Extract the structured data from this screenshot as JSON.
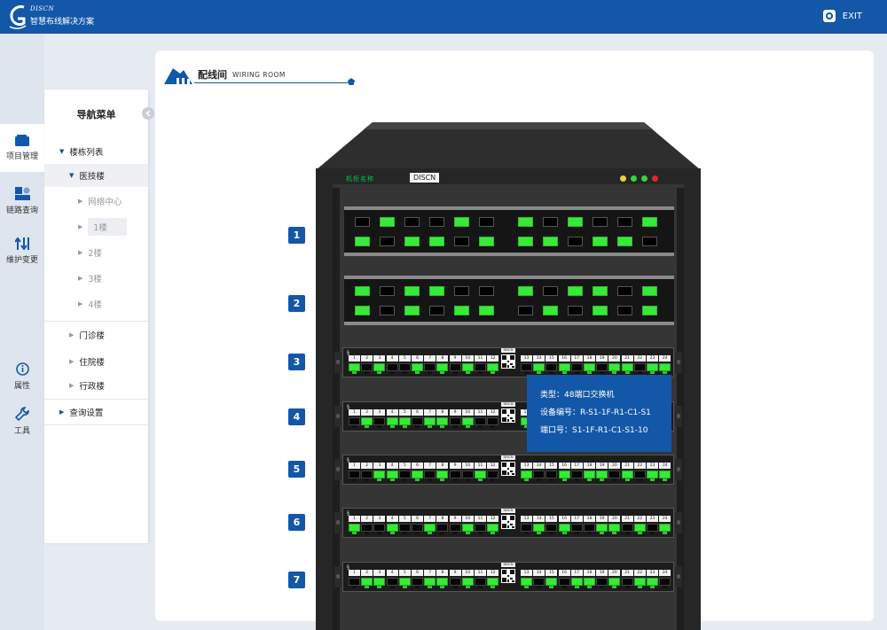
{
  "header": {
    "brand_en": "DISCN",
    "brand_cn": "智慧布线解决方案",
    "exit_label": "EXIT"
  },
  "iconbar": [
    {
      "label": "项目管理",
      "icon": "folder-icon"
    },
    {
      "label": "链路查询",
      "icon": "link-query-icon"
    },
    {
      "label": "维护变更",
      "icon": "maintenance-icon"
    },
    {
      "label": "属性",
      "icon": "info-icon"
    },
    {
      "label": "工具",
      "icon": "wrench-icon"
    }
  ],
  "nav": {
    "title": "导航菜单",
    "building_list": "楼栋列表",
    "medical_building": "医技楼",
    "network_center": "网络中心",
    "floors": [
      "1楼",
      "2楼",
      "3楼",
      "4楼"
    ],
    "outpatient": "门诊楼",
    "inpatient": "住院楼",
    "admin": "行政楼",
    "query_settings": "查询设置"
  },
  "room": {
    "title_cn": "配线间",
    "title_en": "WIRING  ROOM"
  },
  "cabinet": {
    "name_label": "机柜名称",
    "brand": "DISCN",
    "leds": [
      "#e8d33a",
      "#3bd33b",
      "#3bd33b",
      "#e0262b"
    ]
  },
  "units": [
    "1",
    "2",
    "3",
    "4",
    "5",
    "6",
    "7"
  ],
  "patch_panels": [
    {
      "top": [
        0,
        1,
        0,
        0,
        1,
        0,
        1,
        0,
        1,
        0,
        0,
        1
      ],
      "bottom": [
        1,
        0,
        1,
        1,
        0,
        1,
        1,
        1,
        0,
        1,
        1,
        0
      ]
    },
    {
      "top": [
        1,
        0,
        1,
        1,
        0,
        0,
        1,
        0,
        1,
        1,
        0,
        1
      ],
      "bottom": [
        1,
        0,
        1,
        0,
        1,
        1,
        0,
        1,
        0,
        1,
        0,
        1
      ]
    }
  ],
  "switches": {
    "brand": "DISCN",
    "port_labels": [
      "1",
      "2",
      "3",
      "4",
      "5",
      "6",
      "7",
      "8",
      "9",
      "10",
      "11",
      "12",
      "13",
      "14",
      "15",
      "16",
      "17",
      "18",
      "19",
      "20",
      "21",
      "22",
      "23",
      "24"
    ],
    "rows": [
      [
        1,
        0,
        1,
        0,
        0,
        1,
        0,
        1,
        0,
        1,
        0,
        1,
        0,
        1,
        0,
        1,
        0,
        1,
        0,
        1,
        1,
        0,
        1,
        1
      ],
      [
        0,
        1,
        0,
        1,
        1,
        0,
        1,
        1,
        0,
        1,
        0,
        0,
        1,
        0,
        1,
        0,
        1,
        0,
        1,
        1,
        0,
        1,
        0,
        1
      ],
      [
        0,
        0,
        1,
        1,
        0,
        1,
        0,
        1,
        0,
        0,
        1,
        0,
        1,
        0,
        0,
        1,
        0,
        1,
        1,
        0,
        1,
        0,
        1,
        1
      ],
      [
        1,
        0,
        0,
        1,
        0,
        0,
        1,
        0,
        0,
        1,
        0,
        1,
        0,
        1,
        0,
        1,
        0,
        0,
        1,
        1,
        0,
        1,
        0,
        1
      ],
      [
        0,
        1,
        1,
        0,
        1,
        0,
        1,
        1,
        0,
        1,
        0,
        1,
        1,
        0,
        1,
        0,
        1,
        1,
        0,
        1,
        0,
        1,
        1,
        0
      ]
    ]
  },
  "tooltip": {
    "type": "类型：48端口交换机",
    "device_no": "设备编号：R-S1-1F-R1-C1-S1",
    "port_no": "端口号：S1-1F-R1-C1-S1-10"
  }
}
